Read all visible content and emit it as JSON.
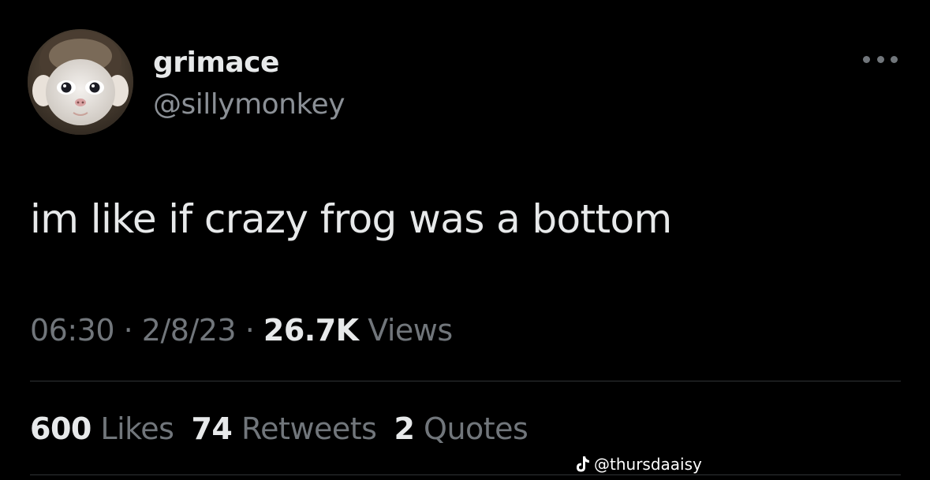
{
  "author": {
    "display_name": "grimace",
    "handle": "@sillymonkey",
    "avatar_icon": "baby-monkey-avatar"
  },
  "tweet": {
    "text": "im like if crazy frog was a bottom",
    "time": "06:30",
    "date": "2/8/23",
    "separator": "·",
    "views_count": "26.7K",
    "views_label": "Views"
  },
  "stats": {
    "likes_count": "600",
    "likes_label": "Likes",
    "retweets_count": "74",
    "retweets_label": "Retweets",
    "quotes_count": "2",
    "quotes_label": "Quotes"
  },
  "watermark": {
    "icon": "tiktok-icon",
    "text": "@thursdaaisy"
  },
  "menu": {
    "icon": "more-options-icon"
  },
  "colors": {
    "background": "#000000",
    "primary_text": "#e7e9ea",
    "secondary_text": "#71767b",
    "divider": "#2f3336"
  }
}
